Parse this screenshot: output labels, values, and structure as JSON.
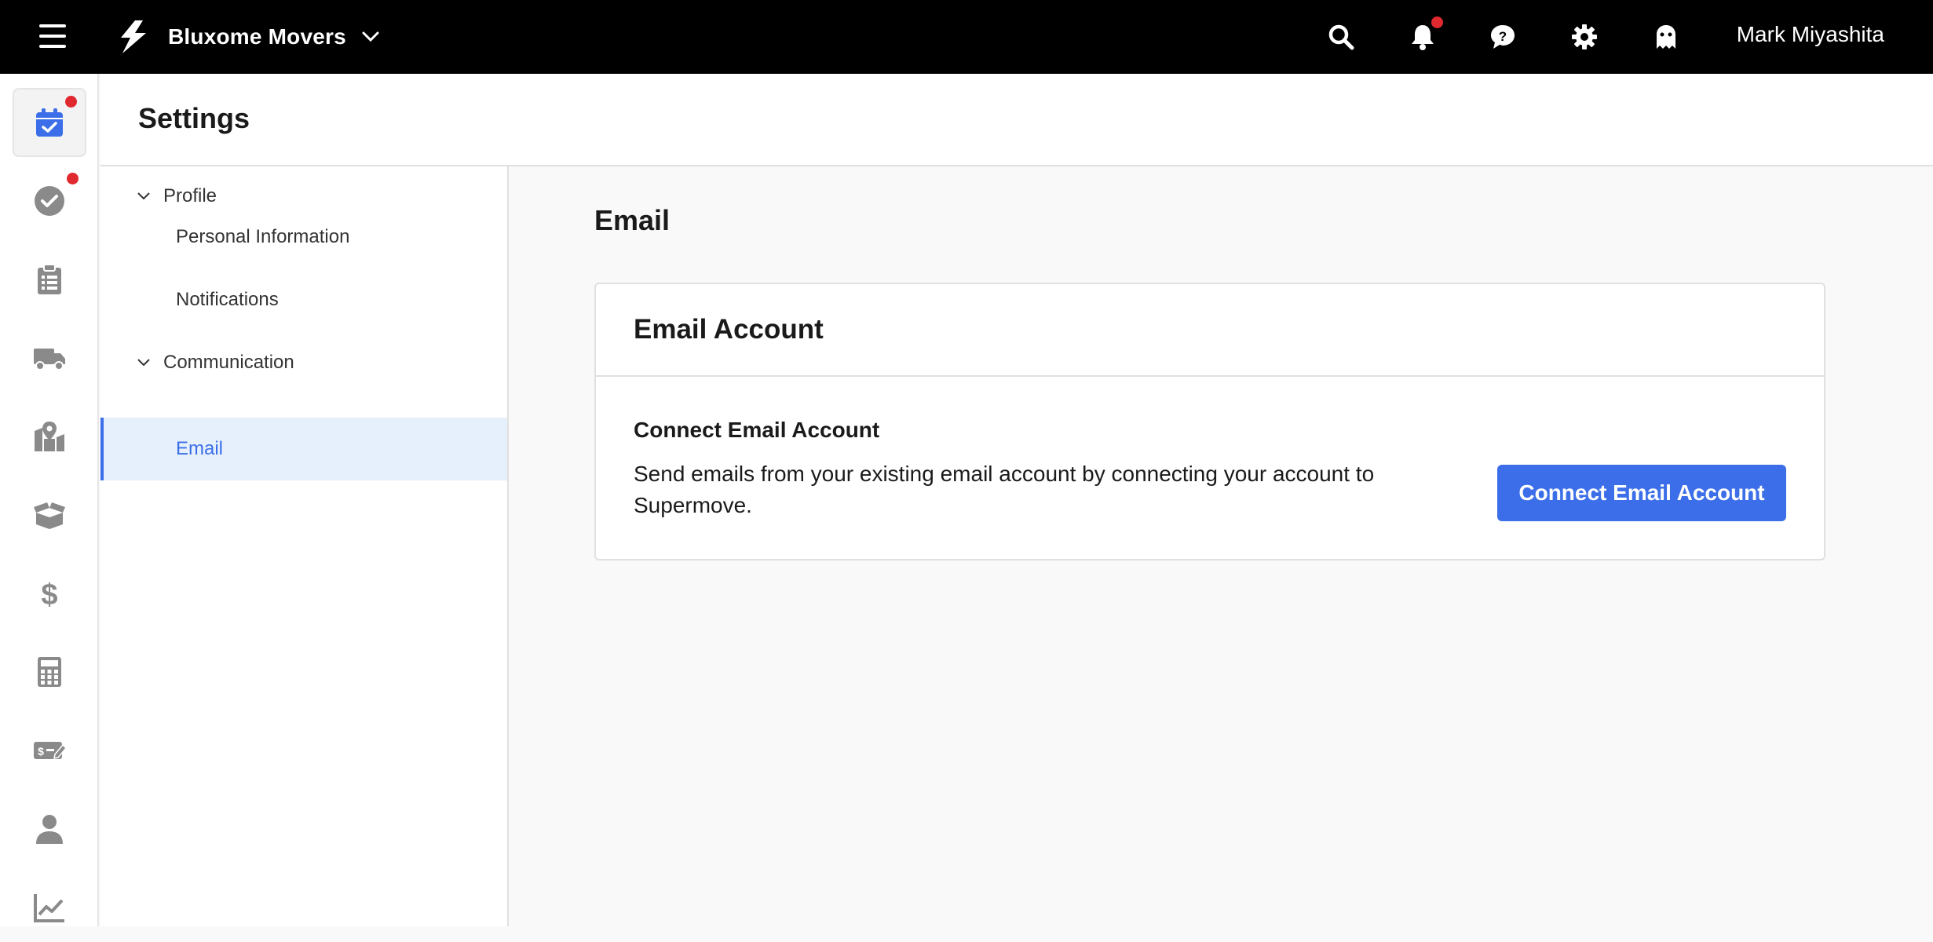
{
  "topbar": {
    "organization": "Bluxome Movers",
    "user_name": "Mark Miyashita",
    "icons": [
      "menu-icon",
      "logo-icon",
      "chevron-down-icon",
      "search-icon",
      "bell-icon",
      "chat-help-icon",
      "gear-icon",
      "ghost-icon"
    ],
    "notification_dot_color": "#e0282f"
  },
  "rail": {
    "items": [
      {
        "icon": "calendar-check-icon",
        "active": true,
        "badge": true
      },
      {
        "icon": "check-circle-icon",
        "active": false,
        "badge": true
      },
      {
        "icon": "clipboard-list-icon",
        "active": false,
        "badge": false
      },
      {
        "icon": "truck-icon",
        "active": false,
        "badge": false
      },
      {
        "icon": "map-marker-icon",
        "active": false,
        "badge": false
      },
      {
        "icon": "box-open-icon",
        "active": false,
        "badge": false
      },
      {
        "icon": "dollar-icon",
        "active": false,
        "badge": false
      },
      {
        "icon": "calculator-icon",
        "active": false,
        "badge": false
      },
      {
        "icon": "money-check-edit-icon",
        "active": false,
        "badge": false
      },
      {
        "icon": "user-icon",
        "active": false,
        "badge": false
      },
      {
        "icon": "chart-line-icon",
        "active": false,
        "badge": false
      }
    ]
  },
  "page": {
    "title": "Settings"
  },
  "settings_nav": {
    "groups": [
      {
        "label": "Profile",
        "items": [
          {
            "label": "Personal Information",
            "active": false
          },
          {
            "label": "Notifications",
            "active": false
          }
        ]
      },
      {
        "label": "Communication",
        "items": [
          {
            "label": "Email",
            "active": true
          }
        ]
      }
    ]
  },
  "content": {
    "title": "Email",
    "card": {
      "header": "Email Account",
      "section_title": "Connect Email Account",
      "description": "Send emails from your existing email account by connecting your account to Supermove.",
      "button_label": "Connect Email Account"
    }
  },
  "colors": {
    "accent": "#3b6ee8",
    "topbar": "#000000",
    "active_nav_bg": "#e6f0fd",
    "badge": "#e0282f",
    "icon_gray": "#8a8a8a"
  }
}
